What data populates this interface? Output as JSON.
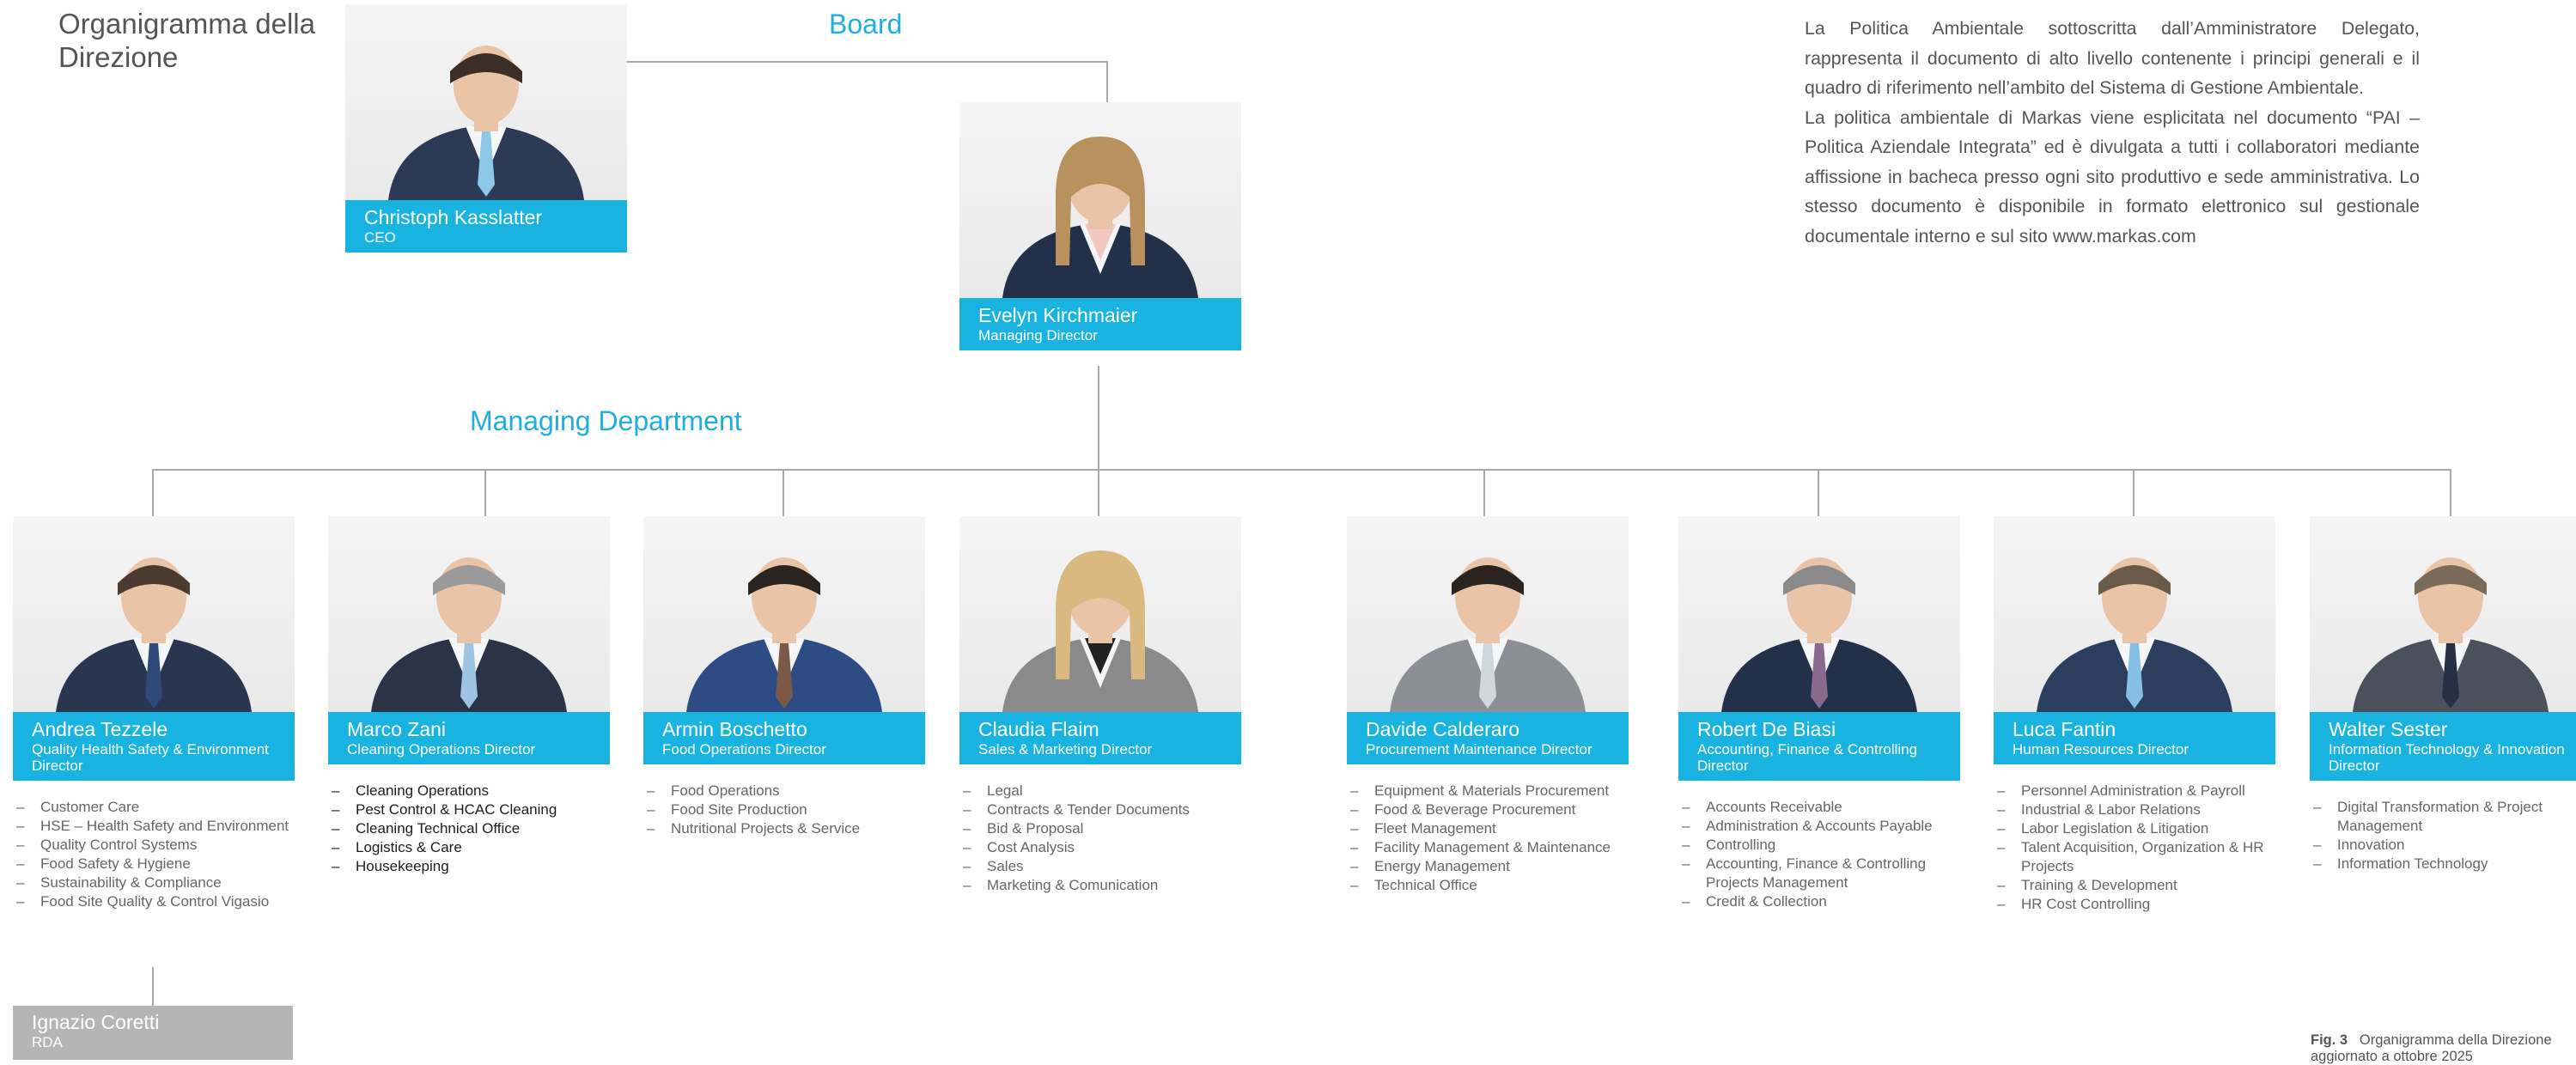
{
  "title": "Organigramma della Direzione",
  "sections": {
    "board": "Board",
    "managing": "Managing Department"
  },
  "policy_text": {
    "p1": "La Politica Ambientale sottoscritta dall’Amministratore Delegato, rappresenta il documento di alto livello contenente i principi generali e il quadro di riferimento nell’ambito del Sistema di Gestione Ambientale.",
    "p2": "La politica ambientale di Markas viene esplicitata nel documento “PAI – Politica Aziendale Integrata” ed è divulgata a tutti i collaboratori mediante affissione in bacheca presso ogni sito produttivo e sede amministrativa. Lo stesso documento è disponibile in formato elettronico sul gestionale documentale interno e sul sito www.markas.com"
  },
  "board": [
    {
      "name": "Christoph Kasslatter",
      "role": "CEO",
      "suit": "#2c3a55",
      "tie": "#8ec8e8",
      "hair": "#3a2e26",
      "gender": "m"
    },
    {
      "name": "Evelyn Kirchmaier",
      "role": "Managing Director",
      "suit": "#23304a",
      "tie": "#f2c9c0",
      "hair": "#b8915f",
      "gender": "f"
    }
  ],
  "directors": [
    {
      "name": "Andrea Tezzele",
      "role": "Quality Health Safety & Environment Director",
      "suit": "#2a3550",
      "tie": "#2f4a7a",
      "hair": "#4a3a30",
      "gender": "m",
      "tasks": [
        "Customer Care",
        "HSE – Health Safety and Environment",
        "Quality Control Systems",
        "Food Safety & Hygiene",
        "Sustainability & Compliance",
        "Food Site Quality & Control Vigasio"
      ]
    },
    {
      "name": "Marco Zani",
      "role": "Cleaning Operations Director",
      "suit": "#2b3347",
      "tie": "#9ec4e4",
      "hair": "#9a9a9a",
      "gender": "m",
      "tasks": [
        "Cleaning Operations",
        "Pest Control & HCAC Cleaning",
        "Cleaning Technical Office",
        "Logistics & Care",
        "Housekeeping"
      ]
    },
    {
      "name": "Armin Boschetto",
      "role": "Food Operations Director",
      "suit": "#2d4c86",
      "tie": "#7a5a46",
      "hair": "#2a2420",
      "gender": "m",
      "tasks": [
        "Food Operations",
        "Food Site Production",
        "Nutritional Projects & Service"
      ]
    },
    {
      "name": "Claudia Flaim",
      "role": "Sales & Marketing Director",
      "suit": "#8a8a8a",
      "tie": "#222222",
      "hair": "#d9b97f",
      "gender": "f",
      "tasks": [
        "Legal",
        "Contracts & Tender Documents",
        "Bid & Proposal",
        "Cost Analysis",
        "Sales",
        "Marketing & Comunication"
      ]
    },
    {
      "name": "Davide Calderaro",
      "role": "Procurement Maintenance Director",
      "suit": "#8c8f96",
      "tie": "#cfd6dc",
      "hair": "#2a2420",
      "gender": "m",
      "tasks": [
        "Equipment & Materials Procurement",
        "Food & Beverage Procurement",
        "Fleet Management",
        "Facility Management & Maintenance",
        "Energy Management",
        "Technical Office"
      ]
    },
    {
      "name": "Robert De Biasi",
      "role": "Accounting, Finance & Controlling Director",
      "suit": "#23304a",
      "tie": "#8a6a8c",
      "hair": "#8a8a8a",
      "gender": "m",
      "tasks": [
        "Accounts Receivable",
        "Administration & Accounts Payable",
        "Controlling",
        "Accounting, Finance & Controlling Projects Management",
        "Credit & Collection"
      ]
    },
    {
      "name": "Luca Fantin",
      "role": "Human Resources Director",
      "suit": "#2c3e5e",
      "tie": "#86bfe6",
      "hair": "#6a5a4a",
      "gender": "m",
      "tasks": [
        "Personnel Administration & Payroll",
        "Industrial & Labor Relations",
        "Labor Legislation & Litigation",
        "Talent Acquisition, Organization & HR Projects",
        "Training & Development",
        "HR Cost Controlling"
      ]
    },
    {
      "name": "Walter Sester",
      "role": "Information Technology & Innovation Director",
      "suit": "#4a505c",
      "tie": "#253045",
      "hair": "#7a6a5a",
      "gender": "m",
      "tasks": [
        "Digital Transformation & Project Management",
        "Innovation",
        "Information Technology"
      ]
    }
  ],
  "rda": {
    "name": "Ignazio Coretti",
    "role": "RDA"
  },
  "caption": {
    "label": "Fig. 3",
    "text": "Organigramma della Direzione",
    "line2": "aggiornato a ottobre 2025"
  }
}
